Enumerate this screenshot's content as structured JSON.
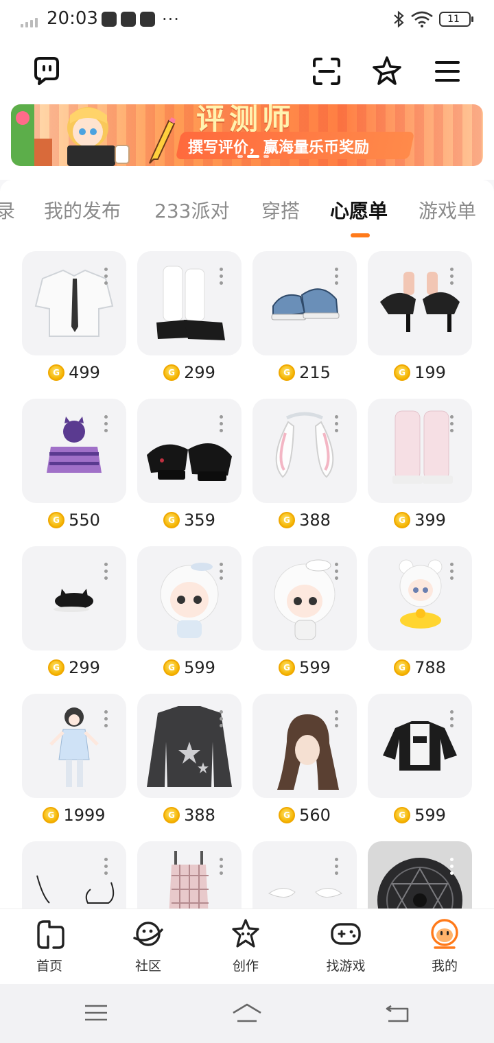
{
  "status_bar": {
    "time": "20:03",
    "battery": "11",
    "more": "···"
  },
  "banner": {
    "title": "评测师",
    "subtitle": "撰写评价，赢海量乐币奖励"
  },
  "tabs": [
    {
      "label": "录",
      "active": false
    },
    {
      "label": "我的发布",
      "active": false
    },
    {
      "label": "233派对",
      "active": false
    },
    {
      "label": "穿搭",
      "active": false
    },
    {
      "label": "心愿单",
      "active": true
    },
    {
      "label": "游戏单",
      "active": false
    }
  ],
  "wishlist": [
    {
      "icon": "white-shirt-tie",
      "price": "499"
    },
    {
      "icon": "white-socks-black-shoes",
      "price": "299"
    },
    {
      "icon": "blue-sneakers",
      "price": "215"
    },
    {
      "icon": "black-bow-heels",
      "price": "199"
    },
    {
      "icon": "purple-cat-hoodie",
      "price": "550"
    },
    {
      "icon": "black-mary-janes",
      "price": "359"
    },
    {
      "icon": "bunny-ear-headband",
      "price": "388"
    },
    {
      "icon": "pink-leg-warmers",
      "price": "399"
    },
    {
      "icon": "black-cat-beret",
      "price": "299"
    },
    {
      "icon": "white-hair-avatar",
      "price": "599"
    },
    {
      "icon": "sailor-hat-avatar",
      "price": "599"
    },
    {
      "icon": "duck-float-avatar",
      "price": "788"
    },
    {
      "icon": "full-avatar-outfit",
      "price": "1999"
    },
    {
      "icon": "grey-star-sweater",
      "price": "388"
    },
    {
      "icon": "brown-wavy-hair",
      "price": "560"
    },
    {
      "icon": "black-white-jacket",
      "price": "599"
    },
    {
      "icon": "glasses-outline",
      "price": ""
    },
    {
      "icon": "pink-plaid-dress",
      "price": ""
    },
    {
      "icon": "white-accessory",
      "price": ""
    },
    {
      "icon": "dark-magic-circle",
      "price": ""
    }
  ],
  "bottom_nav": [
    {
      "label": "首页",
      "icon": "home-icon"
    },
    {
      "label": "社区",
      "icon": "planet-icon"
    },
    {
      "label": "创作",
      "icon": "star-icon"
    },
    {
      "label": "找游戏",
      "icon": "gamepad-icon"
    },
    {
      "label": "我的",
      "icon": "profile-icon",
      "active": true
    }
  ],
  "colors": {
    "accent": "#ff7a1a",
    "coin": "#f4b400"
  }
}
